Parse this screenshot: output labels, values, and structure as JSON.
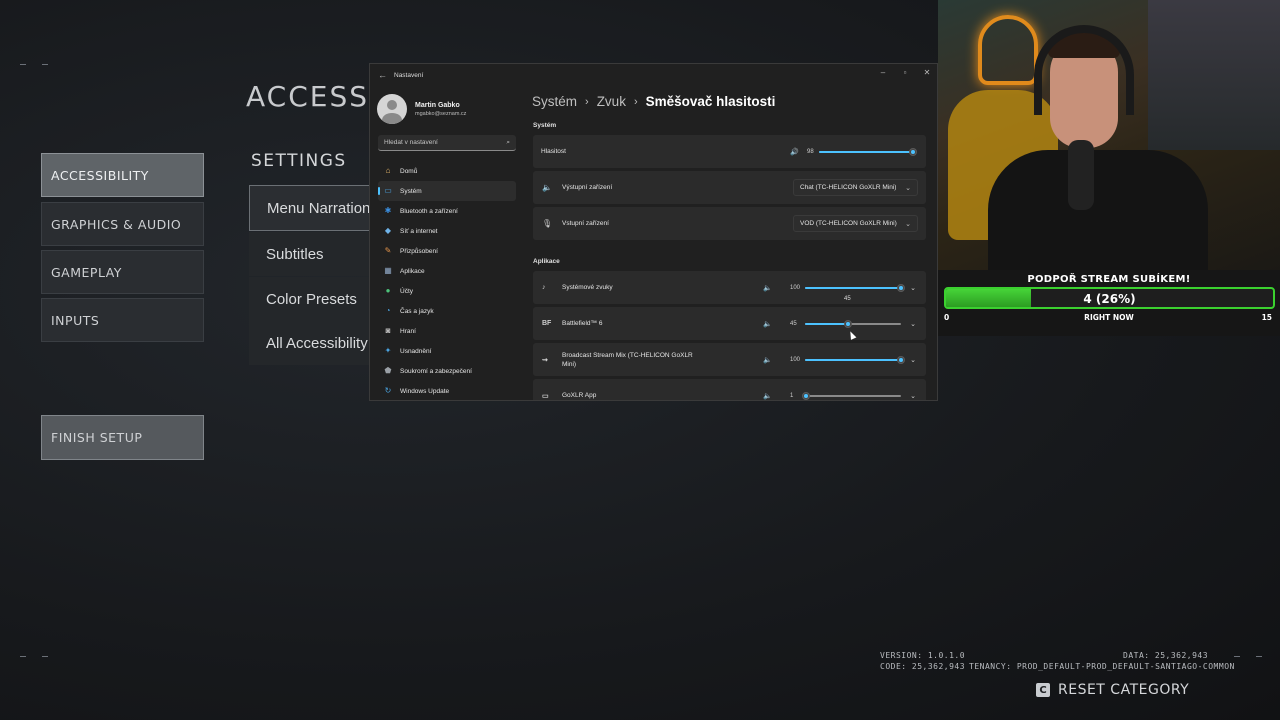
{
  "game": {
    "heading": "ACCESSI",
    "categories": [
      {
        "label": "ACCESSIBILITY",
        "active": true
      },
      {
        "label": "GRAPHICS & AUDIO",
        "active": false
      },
      {
        "label": "GAMEPLAY",
        "active": false
      },
      {
        "label": "INPUTS",
        "active": false
      }
    ],
    "finish_setup": "FINISH SETUP",
    "settings_heading": "SETTINGS",
    "settings_items": [
      {
        "label": "Menu Narration",
        "active": true
      },
      {
        "label": "Subtitles",
        "active": false
      },
      {
        "label": "Color Presets",
        "active": false
      },
      {
        "label": "All Accessibility",
        "active": false
      }
    ],
    "footer": {
      "version": "VERSION: 1.0.1.0",
      "code": "CODE: 25,362,943",
      "data": "DATA: 25,362,943",
      "tenancy": "TENANCY: PROD_DEFAULT-PROD_DEFAULT-SANTIAGO-COMMON"
    },
    "reset_key": "C",
    "reset_label": "RESET CATEGORY"
  },
  "settings_window": {
    "title": "Nastavení",
    "user": {
      "name": "Martin Gabko",
      "email": "mgabko@seznam.cz"
    },
    "search_placeholder": "Hledat v nastavení",
    "nav": [
      {
        "label": "Domů",
        "icon": "home-icon",
        "glyph": "⌂",
        "color": "#e8b86b",
        "active": false
      },
      {
        "label": "Systém",
        "icon": "system-icon",
        "glyph": "▭",
        "color": "#4aa3e0",
        "active": true
      },
      {
        "label": "Bluetooth a zařízení",
        "icon": "bluetooth-icon",
        "glyph": "✱",
        "color": "#3b8fe0",
        "active": false
      },
      {
        "label": "Síť a internet",
        "icon": "network-icon",
        "glyph": "◆",
        "color": "#6fb3e8",
        "active": false
      },
      {
        "label": "Přizpůsobení",
        "icon": "brush-icon",
        "glyph": "✎",
        "color": "#e0924a",
        "active": false
      },
      {
        "label": "Aplikace",
        "icon": "apps-icon",
        "glyph": "▦",
        "color": "#8fa7c4",
        "active": false
      },
      {
        "label": "Účty",
        "icon": "account-icon",
        "glyph": "●",
        "color": "#4cc27a",
        "active": false
      },
      {
        "label": "Čas a jazyk",
        "icon": "time-language-icon",
        "glyph": "◔",
        "color": "#4aa3e0",
        "active": false
      },
      {
        "label": "Hraní",
        "icon": "gaming-icon",
        "glyph": "◙",
        "color": "#b8b8b8",
        "active": false
      },
      {
        "label": "Usnadnění",
        "icon": "accessibility-icon",
        "glyph": "✦",
        "color": "#4aa3e0",
        "active": false
      },
      {
        "label": "Soukromí a zabezpečení",
        "icon": "shield-icon",
        "glyph": "⬟",
        "color": "#9aa0a6",
        "active": false
      },
      {
        "label": "Windows Update",
        "icon": "windows-update-icon",
        "glyph": "↻",
        "color": "#4aa3e0",
        "active": false
      }
    ],
    "breadcrumb": {
      "part1": "Systém",
      "part2": "Zvuk",
      "current": "Směšovač hlasitosti"
    },
    "system_section": "Systém",
    "master_volume": {
      "label": "Hlasitost",
      "value": 98
    },
    "output_device": {
      "label": "Výstupní zařízení",
      "value": "Chat (TC-HELICON GoXLR Mini)"
    },
    "input_device": {
      "label": "Vstupní zařízení",
      "value": "VOD (TC-HELICON GoXLR Mini)"
    },
    "apps_section": "Aplikace",
    "apps": [
      {
        "name": "Systémové zvuky",
        "icon": "system-sounds-icon",
        "glyph": "♪",
        "volume": 100
      },
      {
        "name": "Battlefield™ 6",
        "icon": "battlefield-icon",
        "glyph": "BF",
        "volume": 45
      },
      {
        "name": "Broadcast Stream Mix (TC-HELICON GoXLR Mini)",
        "icon": "broadcast-icon",
        "glyph": "⇝",
        "volume": 100
      },
      {
        "name": "GoXLR App",
        "icon": "goxlr-icon",
        "glyph": "▭",
        "volume": 1
      }
    ],
    "slider_tooltip": "45",
    "accent": "#4cc2ff"
  },
  "stream_goal": {
    "title": "PODPOŘ STREAM SUBÍKEM!",
    "progress_text": "4 (26%)",
    "progress_fraction": 0.26,
    "min": "0",
    "max": "15",
    "now_label": "RIGHT NOW",
    "color": "#3bd12f"
  }
}
